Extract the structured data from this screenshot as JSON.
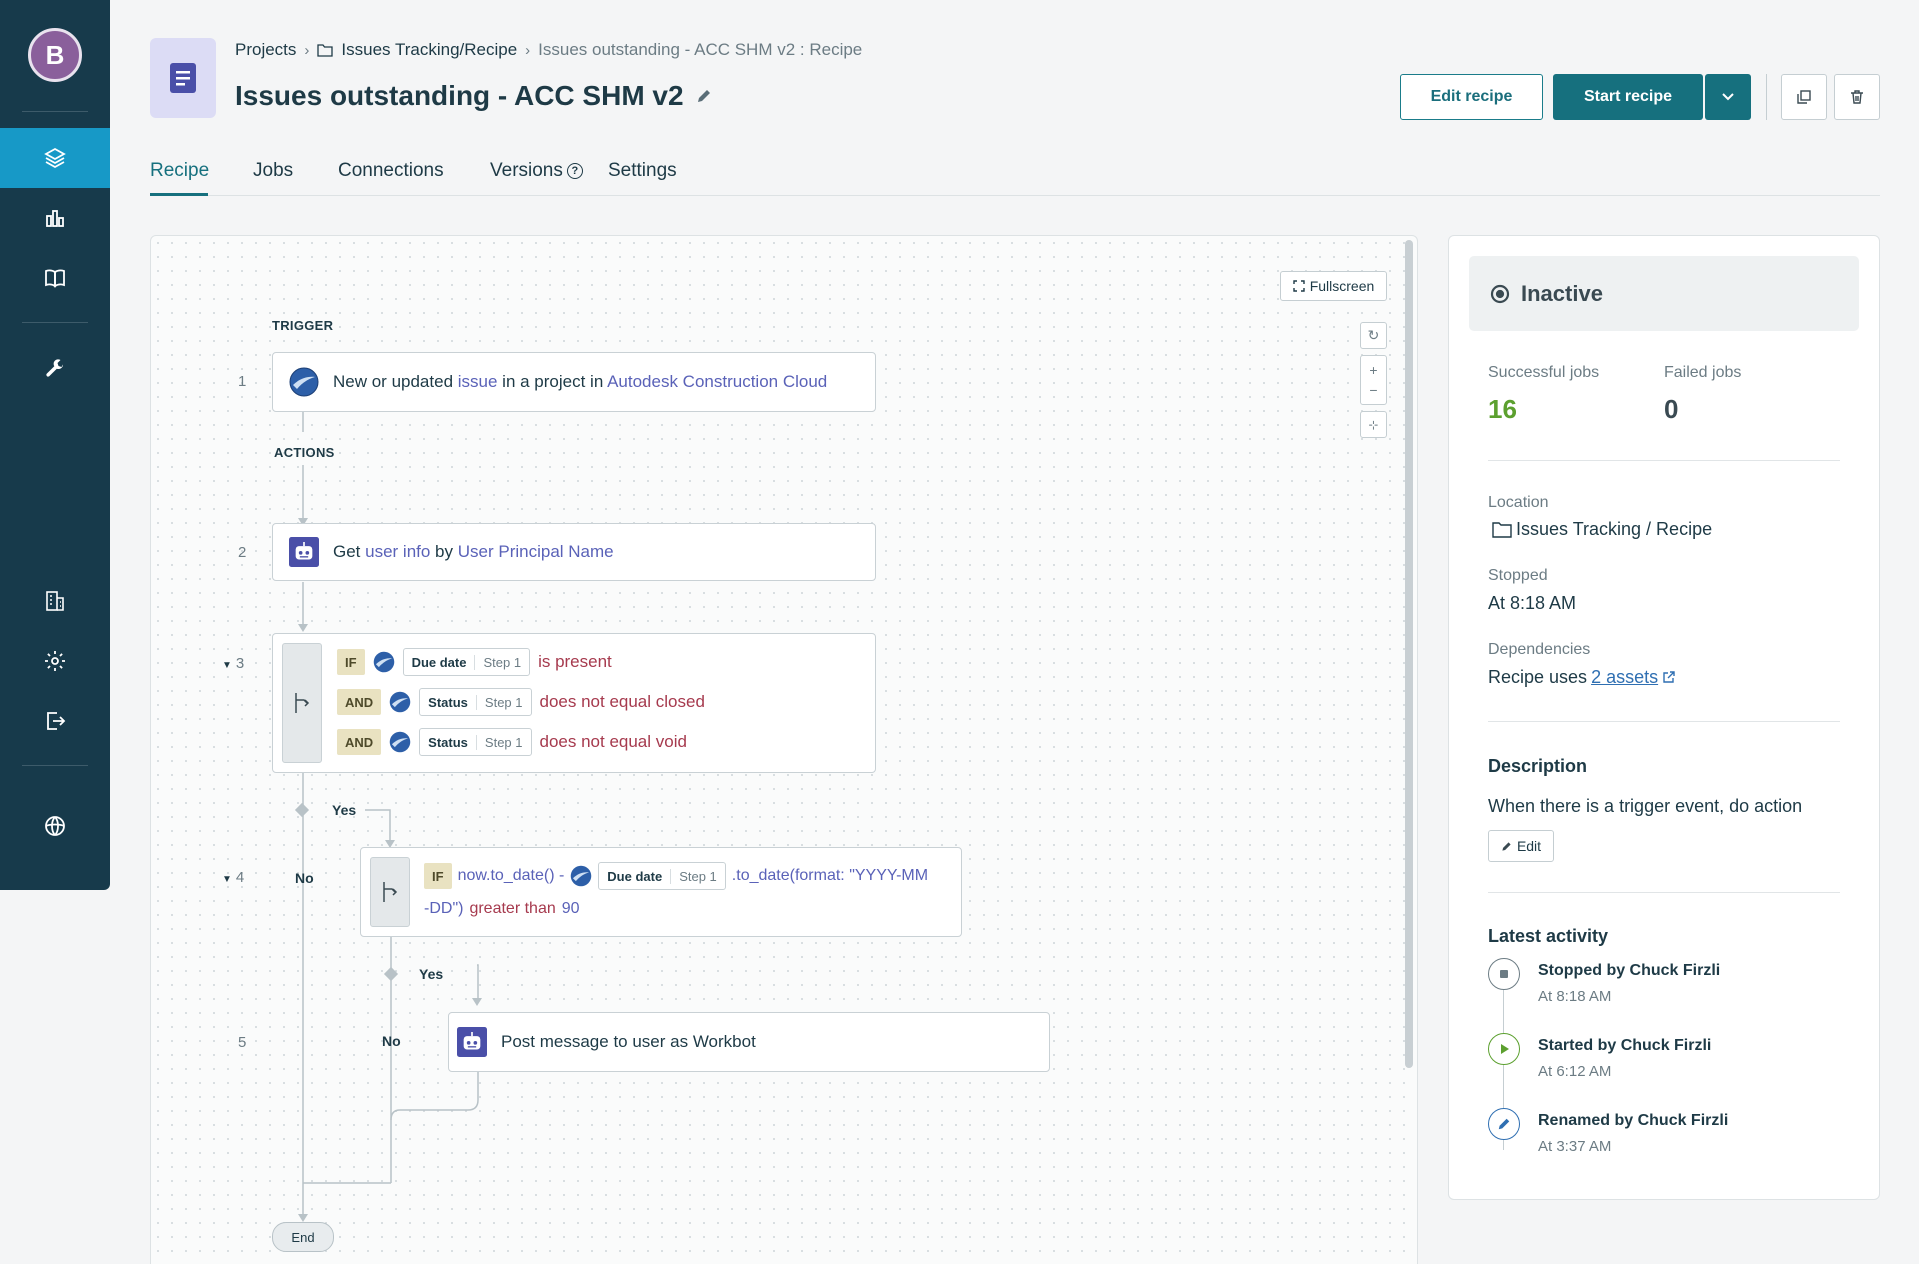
{
  "user": {
    "initial": "B"
  },
  "header": {
    "breadcrumb": [
      "Projects",
      "Issues Tracking/Recipe",
      "Issues outstanding - ACC SHM v2 : Recipe"
    ],
    "title": "Issues outstanding - ACC SHM v2",
    "edit_recipe_label": "Edit recipe",
    "start_recipe_label": "Start recipe"
  },
  "tabs": [
    "Recipe",
    "Jobs",
    "Connections",
    "Versions",
    "Settings"
  ],
  "canvas": {
    "fullscreen_label": "Fullscreen",
    "trigger_label": "TRIGGER",
    "actions_label": "ACTIONS",
    "end_label": "End",
    "steps": {
      "s1": {
        "num": "1",
        "pre": "New or updated ",
        "obj": "issue",
        "mid": " in a project in ",
        "app": "Autodesk Construction Cloud"
      },
      "s2": {
        "num": "2",
        "pre": "Get ",
        "obj": "user info",
        "mid": " by ",
        "field": "User Principal Name"
      },
      "s3": {
        "num": "3",
        "rows": [
          {
            "kw": "IF",
            "pill": "Due date",
            "step": "Step 1",
            "cond": "is present"
          },
          {
            "kw": "AND",
            "pill": "Status",
            "step": "Step 1",
            "cond": "does not equal closed"
          },
          {
            "kw": "AND",
            "pill": "Status",
            "step": "Step 1",
            "cond": "does not equal void"
          }
        ]
      },
      "s4": {
        "num": "4",
        "kw": "IF",
        "pre": "now.to_date() - ",
        "pill": "Due date",
        "step": "Step 1",
        "post": " .to_date(format: \"YYYY-MM",
        "line2": "-DD\")",
        "cond": "greater than",
        "value": "90"
      },
      "s5": {
        "num": "5",
        "text": "Post message to user as Workbot"
      }
    },
    "branch": {
      "yes": "Yes",
      "no": "No"
    }
  },
  "panel": {
    "status": "Inactive",
    "successful_label": "Successful jobs",
    "successful_value": "16",
    "failed_label": "Failed jobs",
    "failed_value": "0",
    "location_label": "Location",
    "location_value": "Issues Tracking / Recipe",
    "stopped_label": "Stopped",
    "stopped_value": "At 8:18 AM",
    "dependencies_label": "Dependencies",
    "dependencies_pre": "Recipe uses ",
    "dependencies_link": "2 assets",
    "description_heading": "Description",
    "description_text": "When there is a trigger event, do action",
    "edit_label": "Edit",
    "activity_heading": "Latest activity",
    "activity": [
      {
        "title": "Stopped by Chuck Firzli",
        "time": "At 8:18 AM"
      },
      {
        "title": "Started by Chuck Firzli",
        "time": "At 6:12 AM"
      },
      {
        "title": "Renamed by Chuck Firzli",
        "time": "At 3:37 AM"
      }
    ]
  },
  "colors": {
    "sidebar": "#173a4b",
    "accent": "#16707e",
    "active_nav": "#1799c7",
    "success": "#5ca02f"
  }
}
